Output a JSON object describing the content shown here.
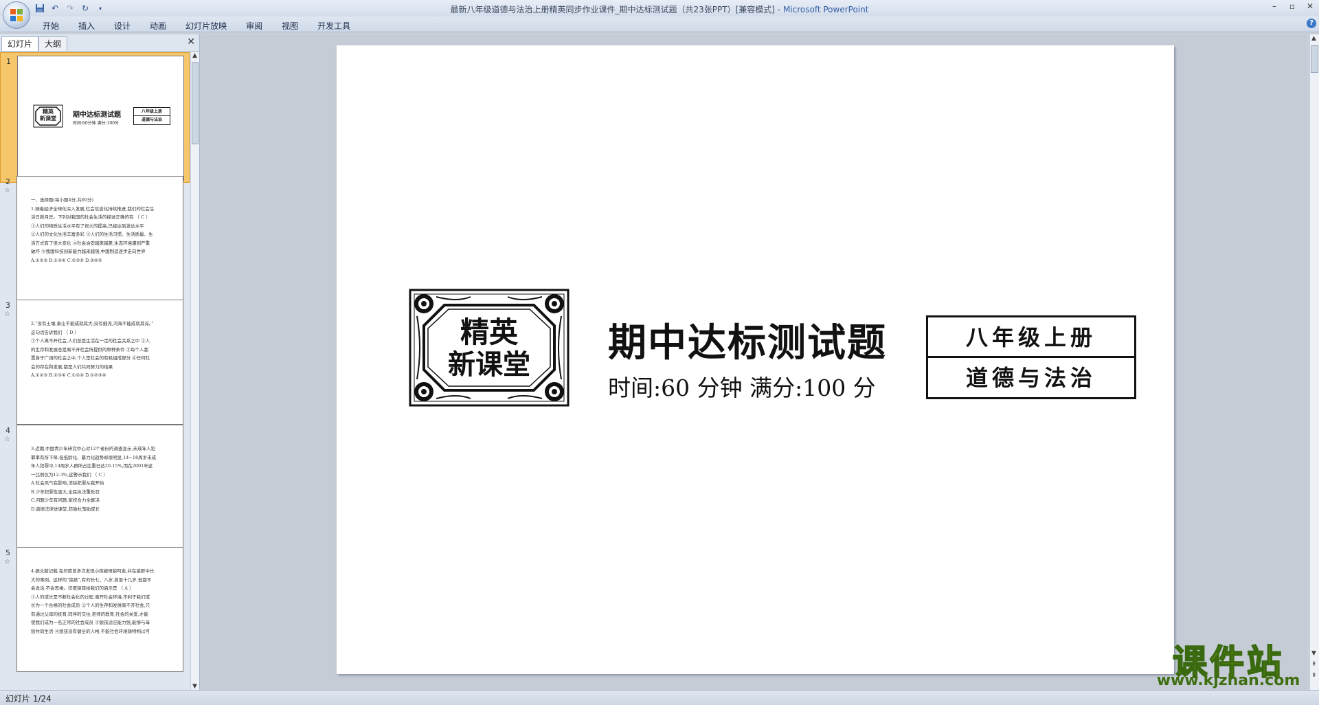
{
  "window": {
    "title": "最新八年级道德与法治上册精英同步作业课件_期中达标测试题（共23张PPT）[兼容模式]",
    "app_name": "Microsoft PowerPoint"
  },
  "ribbon": {
    "tabs": [
      "开始",
      "插入",
      "设计",
      "动画",
      "幻灯片放映",
      "审阅",
      "视图",
      "开发工具"
    ]
  },
  "left_pane": {
    "tabs": {
      "slides": "幻灯片",
      "outline": "大纲"
    },
    "thumbnails": [
      {
        "num": "1",
        "lines": []
      },
      {
        "num": "2",
        "lines": [
          "一、选择题(每小题4分,共60分)",
          "1.随着经济全球化深入发展,社会信息化持续推进,我们的社会生",
          "活日新月异。下列对我国的社会生活的描述正确的有  （  C  ）",
          "①人们的物质生活水平有了很大的提高,已经达到发达水平",
          "②人们的文化生活丰富多彩  ③人们的生活习惯、生活质量、生",
          "活方式有了很大变化  ④社会治安越来越差,生态环境遭到严重",
          "破坏  ⑤我国科技创新能力越来越强,中国制造逐步走向世界",
          "A.①②③        B.①③④        C.②③⑤        D.③④⑤"
        ]
      },
      {
        "num": "3",
        "lines": [
          "2.“没有土壤,泰山不能成就其大;没有细流,河海不能成就其深。”",
          "这句话告诉我们                                                （  D  ）",
          "①个人离不开社会,人们总是生活在一定的社会关系之中  ②人",
          "的生存和发展总是离不开社会所提供的种种条件  ③每个人都",
          "置身于广阔的社会之中,个人是社会的有机组成部分  ④任何社",
          "会的存在和发展,都是人们共同努力的结果",
          "A.①②③        B.②③④        C.①②④        D.①②③④"
        ]
      },
      {
        "num": "4",
        "lines": [
          "3.近期,中国青少年研究中心对12个省份的调查显示,未成年人犯",
          "罪率有所下降,但低龄化、暴力化趋势却很明显,14~18周岁未成",
          "年人犯罪中,14周岁人群所占比重已达20.15%,而在2001年这",
          "一比例仅为12.3%,这警示我们                            （  C  ）",
          "A.社会风气在影响,消除犯罪从我开始",
          "B.少年犯罪危害大,全民执法重处罚",
          "C.问题少年有问题,家校合力全解决",
          "D.道德法律进课堂,防微杜渐助成长"
        ]
      },
      {
        "num": "5",
        "lines": [
          "4.据文献记载,在印度曾多次发现小孩被母狼叼走,并在狼群中长",
          "大的事例。这样的“狼孩”,有的长七、八岁,甚至十几岁,但都不",
          "会说话,不会思维。印度狼孩给我们的启示是            （  A  ）",
          "①人的成长是不断社会化的过程,离开社会环境,不利于我们成",
          "长为一个合格的社会成员  ②个人的生存和发展离不开社会,只",
          "有通过父母的抚育,同伴的交往,老师的教育,社会的关爱,才能",
          "使我们成为一名正常的社会成员  ③狼孩适应能力强,能够与母",
          "狼共同生活  ④狼孩没有健全的人格,不能社会环境铸特构以可"
        ]
      }
    ]
  },
  "slide": {
    "emblem_text": [
      "精英",
      "新课堂"
    ],
    "main_title": "期中达标测试题",
    "time_line": "时间:60 分钟   满分:100 分",
    "grade_top": "八年级上册",
    "grade_bottom": "道德与法治"
  },
  "thumb1": {
    "title": "期中达标测试题",
    "time_line": "时间:60分钟   满分:100分",
    "grade_top": "八年级上册",
    "grade_bottom": "道德与法治"
  },
  "status_bar": {
    "slide_position": "幻灯片 1/24"
  },
  "watermark": {
    "main": "课件站",
    "url": "www.kjzhan.com"
  }
}
